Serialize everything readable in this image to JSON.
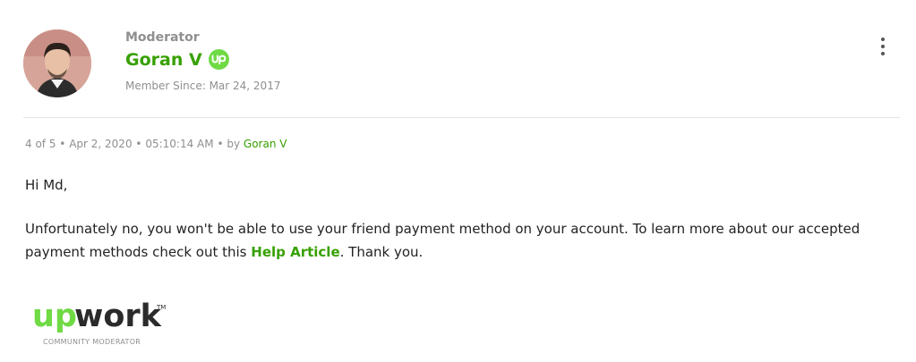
{
  "author": {
    "rank": "Moderator",
    "name": "Goran V",
    "badge_icon": "upwork-badge-icon",
    "member_since": "Member Since: Mar 24, 2017"
  },
  "post": {
    "position": "4 of 5",
    "date": "Apr 2, 2020",
    "time": "05:10:14 AM",
    "by_label": "by",
    "by_author": "Goran V",
    "separator": "•",
    "greeting": "Hi Md,",
    "body_before_link": "Unfortunately no, you won't be able to use your friend payment method on your account. To learn more about our accepted payment methods check out this ",
    "link_text": "Help Article",
    "body_after_link": ". Thank you."
  },
  "signature": {
    "logo_text": "upwork",
    "trademark": "TM",
    "caption": "COMMUNITY MODERATOR"
  },
  "colors": {
    "brand_green": "#37a000",
    "badge_green": "#6fda44",
    "muted_text": "#8f8f8f",
    "body_text": "#222222"
  }
}
